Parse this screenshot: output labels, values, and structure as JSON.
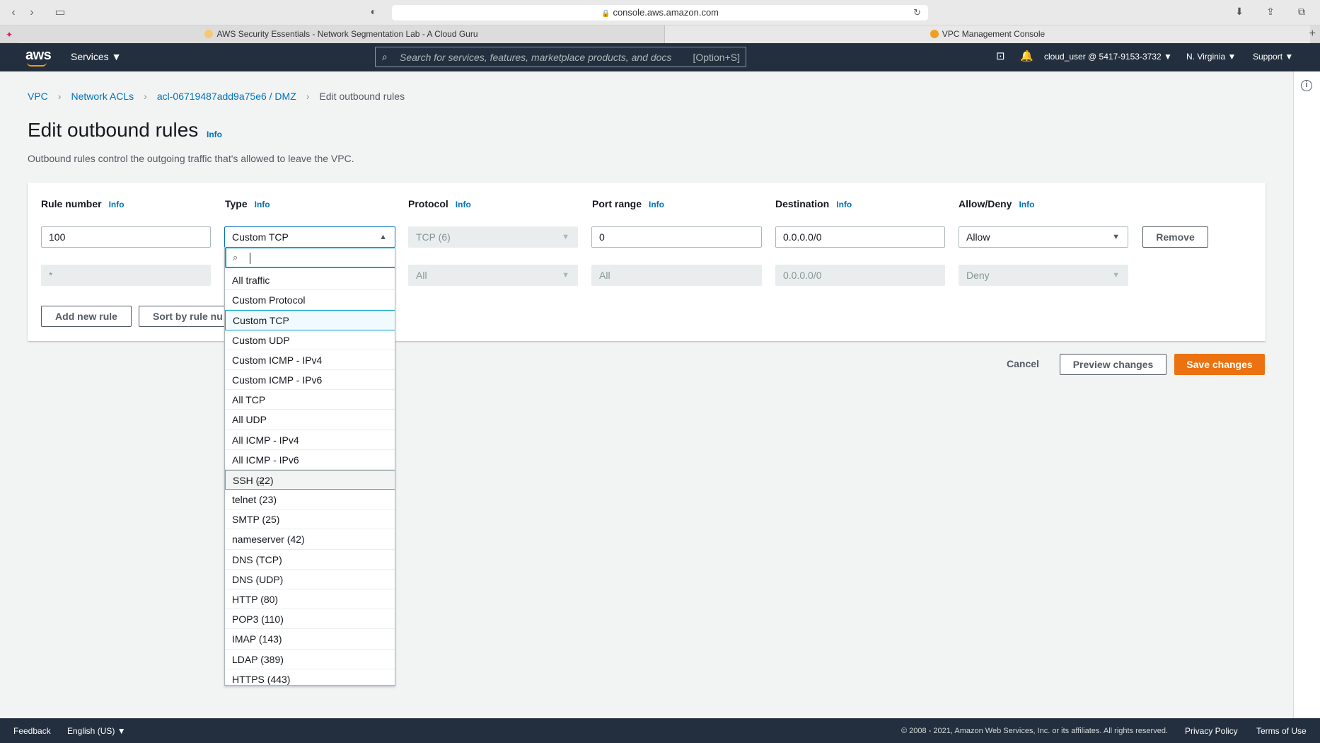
{
  "browser": {
    "url": "console.aws.amazon.com",
    "tabs": [
      {
        "label": "AWS Security Essentials - Network Segmentation Lab - A Cloud Guru",
        "active": false
      },
      {
        "label": "VPC Management Console",
        "active": true
      }
    ]
  },
  "header": {
    "logo": "aws",
    "services_label": "Services ▼",
    "search_placeholder": "Search for services, features, marketplace products, and docs",
    "search_shortcut": "[Option+S]",
    "account": "cloud_user @ 5417-9153-3732 ▼",
    "region": "N. Virginia ▼",
    "support": "Support ▼"
  },
  "breadcrumb": {
    "items": [
      "VPC",
      "Network ACLs",
      "acl-06719487add9a75e6 / DMZ"
    ],
    "current": "Edit outbound rules"
  },
  "page": {
    "title": "Edit outbound rules",
    "info": "Info",
    "description": "Outbound rules control the outgoing traffic that's allowed to leave the VPC."
  },
  "columns": {
    "rule_number": "Rule number",
    "type": "Type",
    "protocol": "Protocol",
    "port_range": "Port range",
    "destination": "Destination",
    "allow_deny": "Allow/Deny",
    "info": "Info"
  },
  "rules": [
    {
      "rule_number": "100",
      "type": "Custom TCP",
      "protocol": "TCP (6)",
      "port_range": "0",
      "destination": "0.0.0.0/0",
      "action": "Allow",
      "remove": "Remove"
    },
    {
      "rule_number": "*",
      "type": "",
      "protocol": "All",
      "port_range": "All",
      "destination": "0.0.0.0/0",
      "action": "Deny"
    }
  ],
  "actions": {
    "add_rule": "Add new rule",
    "sort": "Sort by rule nu",
    "cancel": "Cancel",
    "preview": "Preview changes",
    "save": "Save changes"
  },
  "type_dropdown": {
    "selected": "Custom TCP",
    "hovered": "SSH (22)",
    "options": [
      "All traffic",
      "Custom Protocol",
      "Custom TCP",
      "Custom UDP",
      "Custom ICMP - IPv4",
      "Custom ICMP - IPv6",
      "All TCP",
      "All UDP",
      "All ICMP - IPv4",
      "All ICMP - IPv6",
      "SSH (22)",
      "telnet (23)",
      "SMTP (25)",
      "nameserver (42)",
      "DNS (TCP)",
      "DNS (UDP)",
      "HTTP (80)",
      "POP3 (110)",
      "IMAP (143)",
      "LDAP (389)",
      "HTTPS (443)"
    ]
  },
  "footer": {
    "feedback": "Feedback",
    "language": "English (US) ▼",
    "copyright": "© 2008 - 2021, Amazon Web Services, Inc. or its affiliates. All rights reserved.",
    "privacy": "Privacy Policy",
    "terms": "Terms of Use"
  },
  "colors": {
    "accent": "#0073bb",
    "primary": "#ec7211",
    "header_bg": "#232f3e",
    "focus": "#00a1c9"
  }
}
